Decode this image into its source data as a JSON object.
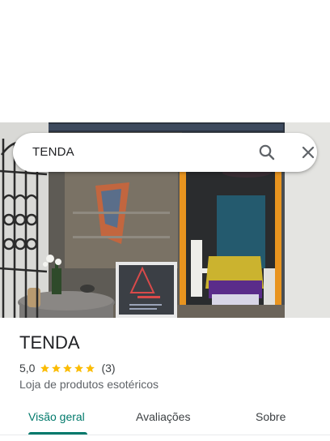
{
  "search": {
    "query": "TENDA"
  },
  "place": {
    "name": "TENDA",
    "rating_value": "5,0",
    "rating_stars": 5,
    "review_count": "(3)",
    "category": "Loja de produtos esotéricos"
  },
  "tabs": [
    {
      "label": "Visão geral",
      "active": true
    },
    {
      "label": "Avaliações",
      "active": false
    },
    {
      "label": "Sobre",
      "active": false
    }
  ],
  "colors": {
    "accent": "#00796b",
    "star": "#fbbc04",
    "text_primary": "#202124",
    "text_secondary": "#5f6368"
  },
  "icons": {
    "search": "search-icon",
    "close": "close-icon",
    "star": "star-icon"
  }
}
